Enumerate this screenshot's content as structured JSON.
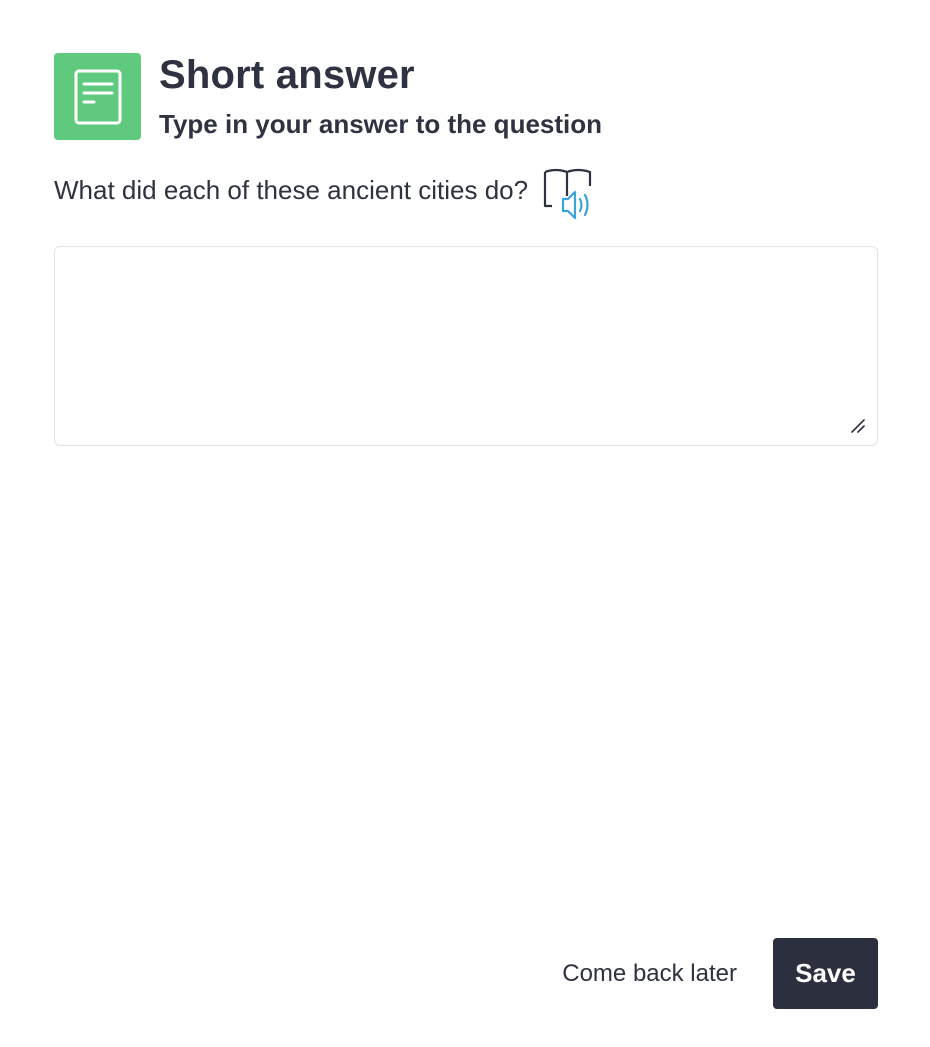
{
  "header": {
    "icon": "short-answer-icon",
    "title": "Short answer",
    "subtitle": "Type in your answer to the question"
  },
  "question": {
    "text": "What did each of these ancient cities do?",
    "read_aloud_icon": "read-aloud-icon"
  },
  "answer": {
    "value": "",
    "placeholder": ""
  },
  "footer": {
    "later_label": "Come back later",
    "save_label": "Save"
  },
  "colors": {
    "icon_bg": "#5fc97e",
    "save_bg": "#2c2f3d",
    "speaker_blue": "#3aa3dc",
    "text": "#2f3240"
  }
}
